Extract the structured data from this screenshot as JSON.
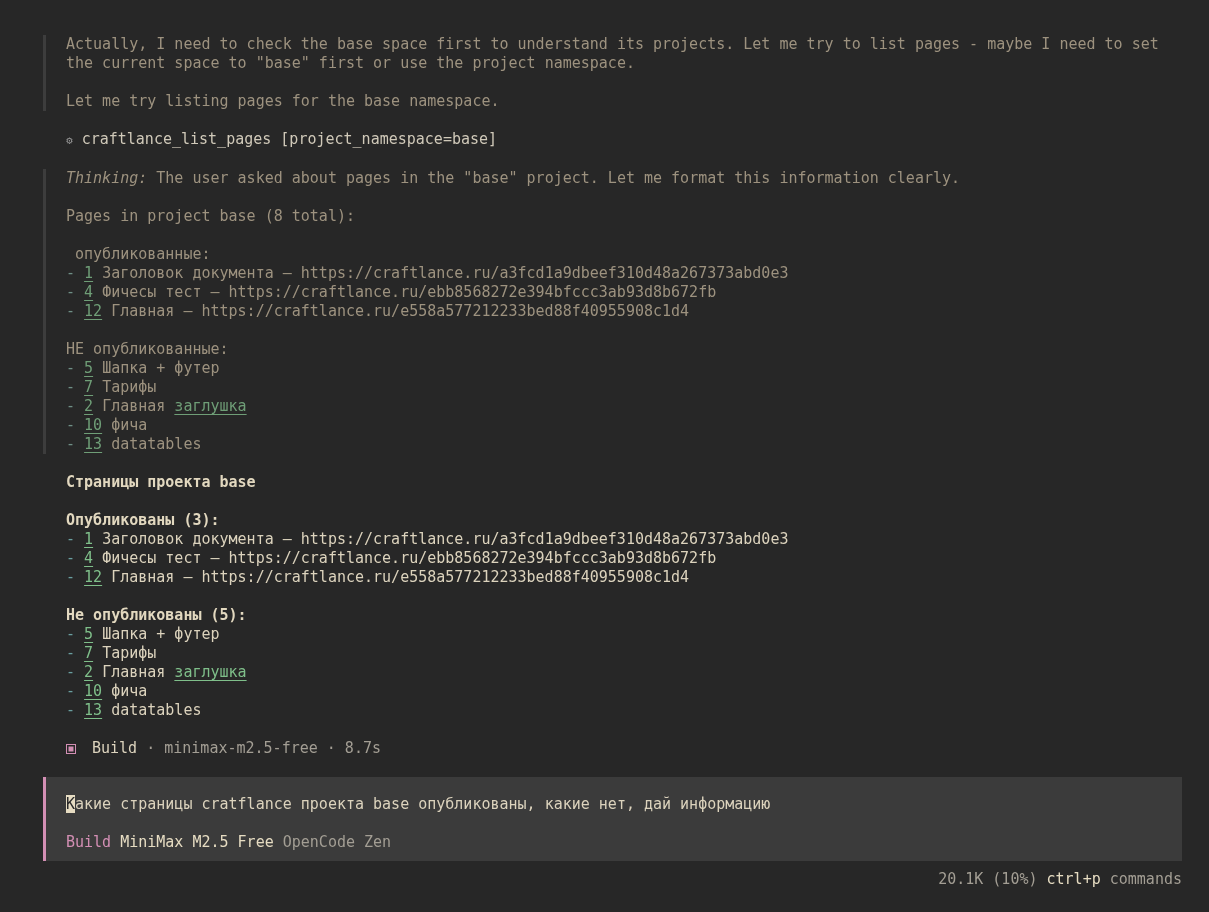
{
  "blocks": [
    {
      "kind": "thinking",
      "paragraphs": [
        [
          {
            "kind": "text",
            "text": "Actually, I need to check the base space first to understand its projects. Let me try to list pages - maybe I need to set"
          },
          {
            "kind": "text",
            "text": "the current space to \"base\" first or use the project namespace."
          }
        ],
        [
          {
            "kind": "text",
            "text": "Let me try listing pages for the base namespace."
          }
        ]
      ]
    },
    {
      "kind": "tool",
      "icon": "⚙",
      "text": "craftlance_list_pages [project_namespace=base]"
    },
    {
      "kind": "thinking",
      "paragraphs": [
        [
          {
            "kind": "text",
            "text": "*Thinking:* The user asked about pages in the \"base\" project. Let me format this information clearly."
          }
        ],
        [
          {
            "kind": "text",
            "text": "Pages in project base (8 total):"
          }
        ],
        [
          {
            "kind": "text",
            "text": " опубликованные:"
          },
          {
            "kind": "item",
            "marker": "-",
            "number": "1",
            "title": "Заголовок документа",
            "url": "— https://craftlance.ru/a3fcd1a9dbeef310d48a267373abd0e3"
          },
          {
            "kind": "item",
            "marker": "-",
            "number": "4",
            "title": "Фичесы тест",
            "url": "— https://craftlance.ru/ebb8568272e394bfccc3ab93d8b672fb"
          },
          {
            "kind": "item",
            "marker": "-",
            "number": "12",
            "title": "Главная",
            "url": "— https://craftlance.ru/e558a577212233bed88f40955908c1d4"
          }
        ],
        [
          {
            "kind": "text",
            "text": "НЕ опубликованные:"
          },
          {
            "kind": "item",
            "marker": "-",
            "number": "5",
            "title": "Шапка + футер"
          },
          {
            "kind": "item",
            "marker": "-",
            "number": "7",
            "title": "Тарифы"
          },
          {
            "kind": "item",
            "marker": "-",
            "number": "2",
            "title": "Главная",
            "link": "заглушка"
          },
          {
            "kind": "item",
            "marker": "-",
            "number": "10",
            "title": "фича"
          },
          {
            "kind": "item",
            "marker": "-",
            "number": "13",
            "title": "datatables"
          }
        ]
      ]
    },
    {
      "kind": "answer",
      "paragraphs": [
        [
          {
            "kind": "heading",
            "text": "Страницы проекта base"
          }
        ],
        [
          {
            "kind": "heading",
            "text": "Опубликованы (3):"
          },
          {
            "kind": "item",
            "marker": "-",
            "number": "1",
            "title": "Заголовок документа",
            "url": "— https://craftlance.ru/a3fcd1a9dbeef310d48a267373abd0e3"
          },
          {
            "kind": "item",
            "marker": "-",
            "number": "4",
            "title": "Фичесы тест",
            "url": "— https://craftlance.ru/ebb8568272e394bfccc3ab93d8b672fb"
          },
          {
            "kind": "item",
            "marker": "-",
            "number": "12",
            "title": "Главная",
            "url": "— https://craftlance.ru/e558a577212233bed88f40955908c1d4"
          }
        ],
        [
          {
            "kind": "heading",
            "text": "Не опубликованы (5):"
          },
          {
            "kind": "item",
            "marker": "-",
            "number": "5",
            "title": "Шапка + футер"
          },
          {
            "kind": "item",
            "marker": "-",
            "number": "7",
            "title": "Тарифы"
          },
          {
            "kind": "item",
            "marker": "-",
            "number": "2",
            "title": "Главная",
            "link": "заглушка"
          },
          {
            "kind": "item",
            "marker": "-",
            "number": "10",
            "title": "фича"
          },
          {
            "kind": "item",
            "marker": "-",
            "number": "13",
            "title": "datatables"
          }
        ]
      ]
    },
    {
      "kind": "status",
      "agent": "Build",
      "details": "· minimax-m2.5-free · 8.7s"
    }
  ],
  "prompt": {
    "value": "Какие страницы cratflance проекта base опубликованы, какие нет, дай информацию",
    "agent": "Build",
    "model": "MiniMax M2.5 Free",
    "provider": "OpenCode Zen"
  },
  "footer": {
    "usage": "20.1K (10%)",
    "shortcut": "ctrl+p",
    "action": "commands"
  }
}
